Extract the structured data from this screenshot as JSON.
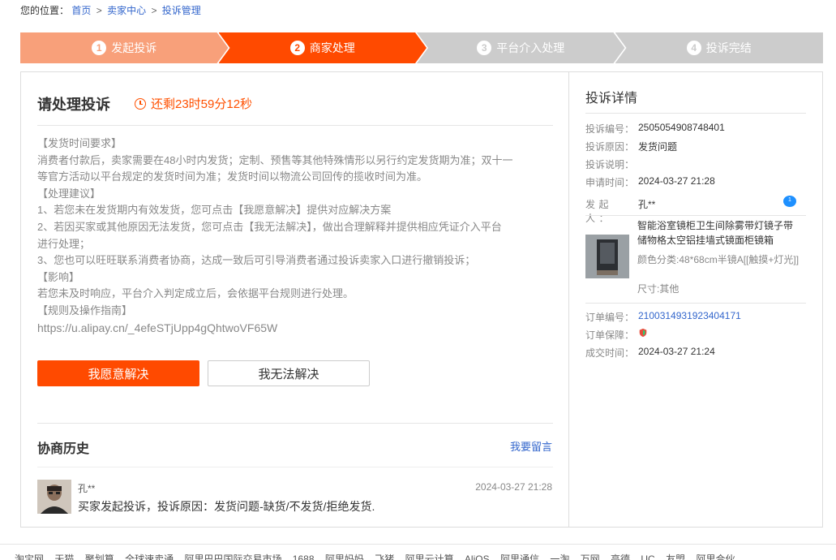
{
  "breadcrumb": {
    "label": "您的位置：",
    "items": [
      "首页",
      "卖家中心",
      "投诉管理"
    ],
    "separator": ">"
  },
  "steps": [
    {
      "num": "1",
      "label": "发起投诉",
      "state": "done"
    },
    {
      "num": "2",
      "label": "商家处理",
      "state": "active"
    },
    {
      "num": "3",
      "label": "平台介入处理",
      "state": "pending"
    },
    {
      "num": "4",
      "label": "投诉完结",
      "state": "pending"
    }
  ],
  "main": {
    "title": "请处理投诉",
    "countdown": "还剩23时59分12秒",
    "notice": [
      "【发货时间要求】",
      "消费者付款后，卖家需要在48小时内发货；定制、预售等其他特殊情形以另行约定发货期为准；双十一",
      "等官方活动以平台规定的发货时间为准；发货时间以物流公司回传的揽收时间为准。",
      "【处理建议】",
      "1、若您未在发货期内有效发货，您可点击【我愿意解决】提供对应解决方案",
      "2、若因买家或其他原因无法发货，您可点击【我无法解决】，做出合理解释并提供相应凭证介入平台",
      "进行处理；",
      "3、您也可以旺旺联系消费者协商，达成一致后可引导消费者通过投诉卖家入口进行撤销投诉；",
      "【影响】",
      "若您未及时响应，平台介入判定成立后，会依据平台规则进行处理。",
      "【规则及操作指南】",
      "https://u.alipay.cn/_4efeSTjUpp4gQhtwoVF65W"
    ],
    "btn_accept": "我愿意解决",
    "btn_reject": "我无法解决",
    "history_title": "协商历史",
    "leave_msg": "我要留言",
    "message": {
      "name": "孔**",
      "time": "2024-03-27 21:28",
      "text": "买家发起投诉，投诉原因：发货问题-缺货/不发货/拒绝发货."
    }
  },
  "detail": {
    "title": "投诉详情",
    "complaint_no_label": "投诉编号：",
    "complaint_no": "2505054908748401",
    "reason_label": "投诉原因：",
    "reason": "发货问题",
    "desc_label": "投诉说明：",
    "desc": "",
    "apply_time_label": "申请时间：",
    "apply_time": "2024-03-27 21:28",
    "initiator_label": "发起人：",
    "initiator": "孔**",
    "product_title": "智能浴室镜柜卫生间除雾带灯镜子带储物格太空铝挂墙式镜面柜镜箱",
    "product_sku": "颜色分类:48*68cm半镜A[[触摸+灯光]]",
    "product_size": "尺寸:其他",
    "order_no_label": "订单编号：",
    "order_no": "2100314931923404171",
    "guarantee_label": "订单保障：",
    "deal_time_label": "成交时间：",
    "deal_time": "2024-03-27 21:24"
  },
  "footer": [
    "淘宝网",
    "天猫",
    "聚划算",
    "全球速卖通",
    "阿里巴巴国际交易市场",
    "1688",
    "阿里妈妈",
    "飞猪",
    "阿里云计算",
    "AliOS",
    "阿里通信",
    "一淘",
    "万网",
    "高德",
    "UC",
    "友盟",
    "阿里合伙"
  ],
  "colors": {
    "accent": "#ff4a00",
    "step_done": "#f8a07a",
    "step_pending": "#cccccc",
    "link": "#3366cc"
  }
}
